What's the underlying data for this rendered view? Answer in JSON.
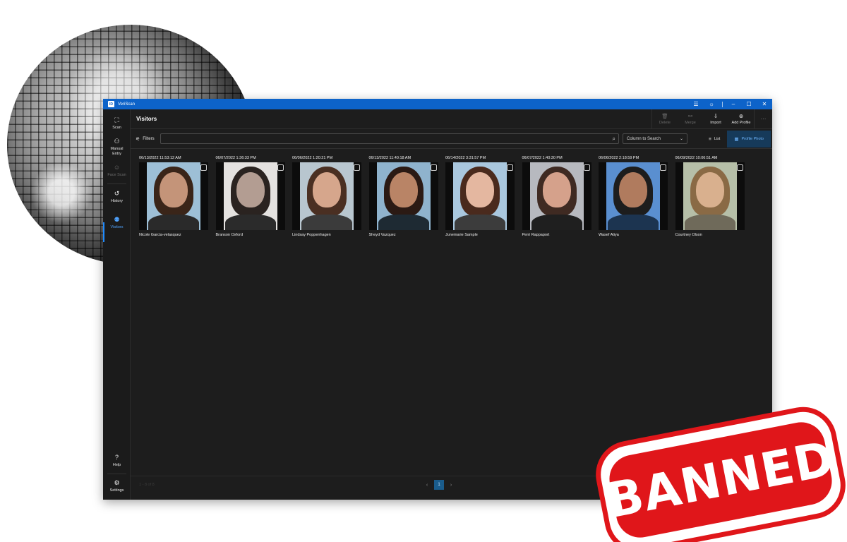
{
  "app": {
    "title": "VeriScan",
    "logo_text": "ID"
  },
  "titlebar": {
    "icons": [
      "server-icon",
      "sun-icon",
      "minimize-icon",
      "maximize-icon",
      "close-icon"
    ],
    "glyphs": {
      "server": "☰",
      "theme": "☼",
      "minimize": "–",
      "maximize": "☐",
      "close": "✕"
    }
  },
  "sidebar": {
    "items": [
      {
        "label": "Scan",
        "icon": "scan-icon",
        "glyph": "⛶"
      },
      {
        "label": "Manual Entry",
        "icon": "manual-entry-icon",
        "glyph": "⚇"
      },
      {
        "label": "Face Scan",
        "icon": "face-scan-icon",
        "glyph": "☺"
      },
      {
        "label": "History",
        "icon": "history-icon",
        "glyph": "↺"
      },
      {
        "label": "Visitors",
        "icon": "visitors-icon",
        "glyph": "⚉"
      }
    ],
    "bottom": [
      {
        "label": "Help",
        "icon": "help-icon",
        "glyph": "?"
      },
      {
        "label": "Settings",
        "icon": "settings-icon",
        "glyph": "⚙"
      }
    ]
  },
  "header": {
    "title": "Visitors",
    "actions": [
      {
        "label": "Delete",
        "icon": "trash-icon",
        "glyph": "🗑",
        "enabled": false
      },
      {
        "label": "Merge",
        "icon": "merge-icon",
        "glyph": "⚯",
        "enabled": false
      },
      {
        "label": "Import",
        "icon": "import-icon",
        "glyph": "⇩",
        "enabled": true
      },
      {
        "label": "Add Profile",
        "icon": "add-profile-icon",
        "glyph": "⊕",
        "enabled": true
      }
    ],
    "more": "⋯"
  },
  "toolbar": {
    "filters_label": "Filters",
    "filters_glyph": "⚟",
    "search_value": "",
    "search_glyph": "⌕",
    "column_select": "Column to Search",
    "select_glyph": "⌄",
    "views": [
      {
        "label": "List",
        "glyph": "≡",
        "active": false
      },
      {
        "label": "Profile Photo",
        "glyph": "▦",
        "active": true
      }
    ]
  },
  "visitors": [
    {
      "date": "06/13/2022 11:53:12 AM",
      "name": "Nicole Garcia-velasquez",
      "bg": "#9dbfd6",
      "hair": "#3a2519",
      "skin": "#c49479",
      "shirt": "#2a2a2a"
    },
    {
      "date": "06/07/2022 1:36:33 PM",
      "name": "Branson Oxford",
      "bg": "#e4e2e0",
      "hair": "#2a2320",
      "skin": "#b39d92",
      "shirt": "#2b2b2b"
    },
    {
      "date": "06/06/2022 1:20:21 PM",
      "name": "Lindsay Poppenhagen",
      "bg": "#b8c6cf",
      "hair": "#4a2f22",
      "skin": "#d6a68c",
      "shirt": "#3b3b3b"
    },
    {
      "date": "06/13/2022 11:40:18 AM",
      "name": "Sheyd Vazquez",
      "bg": "#8fb3cd",
      "hair": "#2b1a14",
      "skin": "#b98466",
      "shirt": "#1e2a33"
    },
    {
      "date": "06/14/2022 3:31:57 PM",
      "name": "Junemarie Sample",
      "bg": "#a9c7de",
      "hair": "#4a2a1d",
      "skin": "#e4b7a0",
      "shirt": "#3c3c3c"
    },
    {
      "date": "06/07/2022 1:40:30 PM",
      "name": "Perri Rappaport",
      "bg": "#b7b9bf",
      "hair": "#3f2a22",
      "skin": "#d5a18b",
      "shirt": "#1f1f1f"
    },
    {
      "date": "06/06/2022 2:18:59 PM",
      "name": "Wasef Atiya",
      "bg": "#5a8fd0",
      "hair": "#1d1d1d",
      "skin": "#b07b5e",
      "shirt": "#1c3450"
    },
    {
      "date": "06/09/2022 10:06:51 AM",
      "name": "Courtney Olson",
      "bg": "#b6bfa8",
      "hair": "#8a6a45",
      "skin": "#d9b08e",
      "shirt": "#6f6a5a"
    }
  ],
  "footer": {
    "count_text": "1 - 8 of 8",
    "current_page": "1",
    "prev": "‹",
    "next": "›"
  },
  "stamp": {
    "text": "BANNED",
    "color": "#e0161a"
  }
}
